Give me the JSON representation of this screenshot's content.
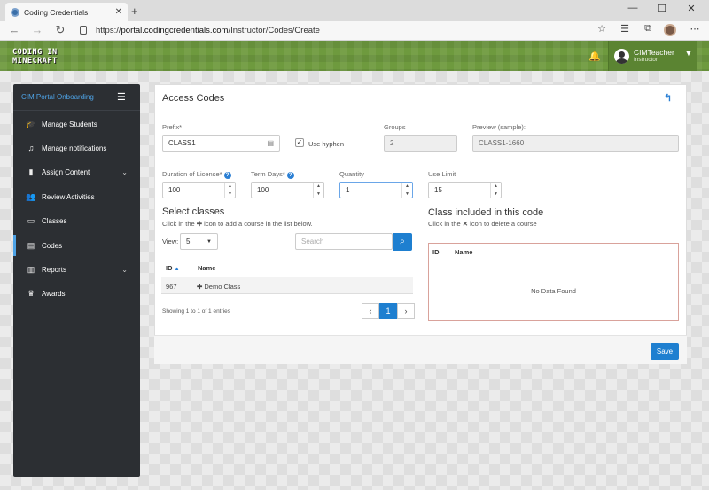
{
  "browser": {
    "tab_title": "Coding Credentials",
    "tab_close": "✕",
    "new_tab": "+",
    "url_prefix": "https://",
    "url_host": "portal.codingcredentials.com",
    "url_path": "/Instructor/Codes/Create",
    "controls": {
      "minimize": "—",
      "maximize": "☐",
      "close": "✕"
    }
  },
  "header": {
    "logo_line1": "CODING IN",
    "logo_line2": "MINECRAFT",
    "user_name": "CIMTeacher",
    "user_role": "Instructor"
  },
  "sidebar": {
    "title": "CIM Portal Onboarding",
    "items": [
      {
        "label": "Manage Students",
        "icon": "graduation-cap-icon"
      },
      {
        "label": "Manage notifications",
        "icon": "bell-icon"
      },
      {
        "label": "Assign Content",
        "icon": "clipboard-icon"
      },
      {
        "label": "Review Activities",
        "icon": "user-review-icon"
      },
      {
        "label": "Classes",
        "icon": "classroom-icon"
      },
      {
        "label": "Codes",
        "icon": "card-icon"
      },
      {
        "label": "Reports",
        "icon": "bar-chart-icon"
      },
      {
        "label": "Awards",
        "icon": "trophy-icon"
      }
    ]
  },
  "form": {
    "title": "Access Codes",
    "prefix_label": "Prefix*",
    "prefix_value": "CLASS1",
    "use_hyphen_label": "Use hyphen",
    "use_hyphen_checked": true,
    "groups_label": "Groups",
    "groups_value": "2",
    "preview_label": "Preview (sample):",
    "preview_value": "CLASS1-1660",
    "duration_label": "Duration of License*",
    "duration_value": "100",
    "term_label": "Term Days*",
    "term_value": "100",
    "quantity_label": "Quantity",
    "quantity_value": "1",
    "use_limit_label": "Use Limit",
    "use_limit_value": "15"
  },
  "select_classes": {
    "title": "Select classes",
    "hint_before": "Click in the",
    "hint_after": "icon to add a course in the list below.",
    "view_label": "View:",
    "view_value": "5",
    "search_placeholder": "Search",
    "columns": [
      "ID",
      "Name"
    ],
    "rows": [
      {
        "id": "967",
        "name": "Demo Class"
      }
    ],
    "showing": "Showing 1 to 1 of 1 entries",
    "current_page": "1"
  },
  "included": {
    "title": "Class included in this code",
    "hint_before": "Click in the",
    "hint_after": "icon to delete a course",
    "columns": [
      "ID",
      "Name"
    ],
    "empty": "No Data Found"
  },
  "save_label": "Save"
}
